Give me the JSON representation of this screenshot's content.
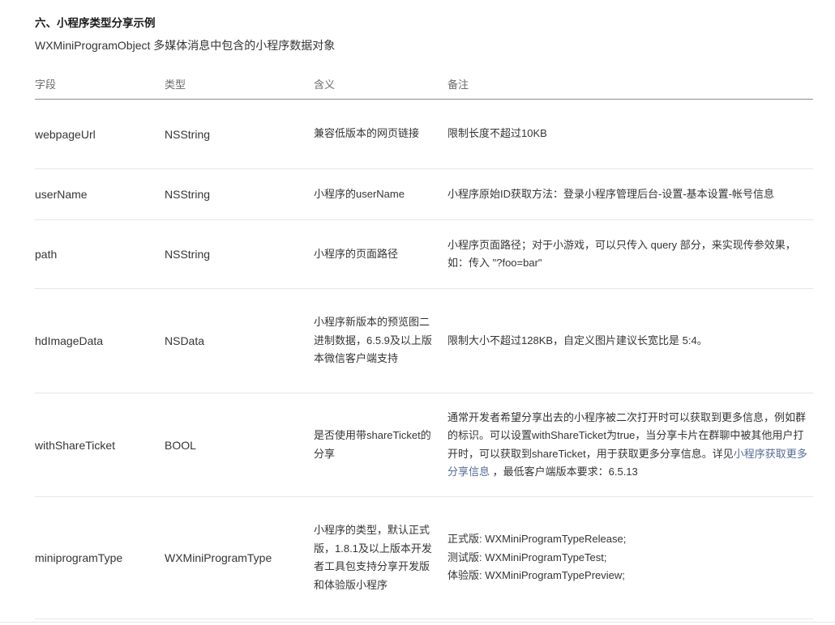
{
  "section": {
    "title": "六、小程序类型分享示例",
    "subtitle": "WXMiniProgramObject 多媒体消息中包含的小程序数据对象"
  },
  "table": {
    "headers": [
      "字段",
      "类型",
      "含义",
      "备注"
    ],
    "rows": [
      {
        "field": "webpageUrl",
        "type": "NSString",
        "meaning": "兼容低版本的网页链接",
        "note": "限制长度不超过10KB"
      },
      {
        "field": "userName",
        "type": "NSString",
        "meaning": "小程序的userName",
        "note": "小程序原始ID获取方法：登录小程序管理后台-设置-基本设置-帐号信息"
      },
      {
        "field": "path",
        "type": "NSString",
        "meaning": "小程序的页面路径",
        "note": "小程序页面路径；对于小游戏，可以只传入 query 部分，来实现传参效果，如：传入 \"?foo=bar\""
      },
      {
        "field": "hdImageData",
        "type": "NSData",
        "meaning": "小程序新版本的预览图二进制数据，6.5.9及以上版本微信客户端支持",
        "note": "限制大小不超过128KB，自定义图片建议长宽比是 5:4。"
      },
      {
        "field": "withShareTicket",
        "type": "BOOL",
        "meaning": "是否使用带shareTicket的分享",
        "note_before": "通常开发者希望分享出去的小程序被二次打开时可以获取到更多信息，例如群的标识。可以设置withShareTicket为true，当分享卡片在群聊中被其他用户打开时，可以获取到shareTicket，用于获取更多分享信息。详见",
        "note_link": "小程序获取更多分享信息",
        "note_after": " ，最低客户端版本要求：6.5.13"
      },
      {
        "field": "miniprogramType",
        "type": "WXMiniProgramType",
        "meaning": "小程序的类型，默认正式版，1.8.1及以上版本开发者工具包支持分享开发版和体验版小程序",
        "note_lines": [
          "正式版: WXMiniProgramTypeRelease;",
          "测试版: WXMiniProgramTypeTest;",
          "体验版: WXMiniProgramTypePreview;"
        ]
      }
    ]
  }
}
